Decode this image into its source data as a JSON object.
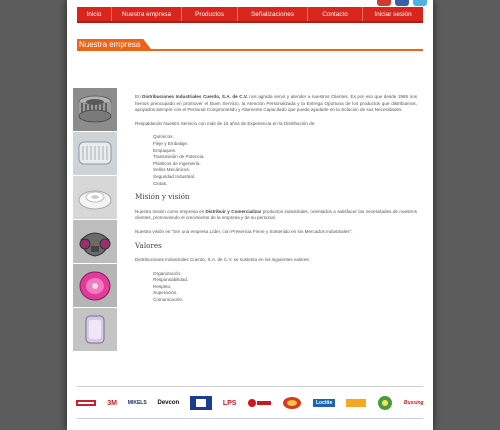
{
  "nav": {
    "items": [
      "Inicio",
      "Nuestra empresa",
      "Productos",
      "Señalizaciones",
      "Contacto",
      "Iniciar sesión"
    ]
  },
  "section_title": "Nuestra empresa",
  "intro": {
    "prefix": "En ",
    "company": "Distribuciones Industriales Cuerdo, S.A. de C.V.",
    "text": " nos agrada servir y atender a nuestros Clientes. Es por eso que desde 1986 nos hemos preocupado en promover el Buen Servicio, la Atención Personalizada y la Entrega Oportuna de los productos que distribuimos, apoyados siempre con el Personal Comprometido y Altamente Capacitado que puede ayudarle en la Solución de sus Necesidades."
  },
  "support_text": "Respaldando Nuestro Servicio con más de 15 años de Experiencia en la Distribución de:",
  "products": [
    "Químicos.",
    "Fleje y Embalaje.",
    "Empaques.",
    "Transmisión de Potencia.",
    "Plásticos de Ingeniería.",
    "Sellos Mecánicos.",
    "Seguridad Industrial.",
    "Cintas."
  ],
  "mission": {
    "heading": "Misión y visión",
    "prefix": "Nuestra misión como empresa es ",
    "bold": "Distribuir y Comercializar",
    "text": " productos industriales, orientados a satisfacer las necesidades de nuestros clientes, promoviendo el crecimiento de la empresa y de su personal.",
    "vision": "Nuestra visión es \"Ser una empresa Líder, con Presencia Firme y Sostenido en los Mercados Industriales\"."
  },
  "values": {
    "heading": "Valores",
    "intro": "Distribuciones Industriales Cuerdo, S.A. de C.V. se sustenta en los siguientes valores:",
    "items": [
      "Organización.",
      "Responsabilidad.",
      "Respeto.",
      "Superación.",
      "Comunicación."
    ]
  },
  "brands": [
    "3M",
    "MIKELS",
    "Devcon",
    "LPS",
    "Loctite",
    "Tuk",
    "Bussing"
  ],
  "colors": {
    "accent": "#d9261c",
    "title_bar": "#ec6417",
    "background": "#5c5c5c"
  },
  "social_icons": [
    "youtube-icon",
    "facebook-icon",
    "twitter-icon"
  ]
}
